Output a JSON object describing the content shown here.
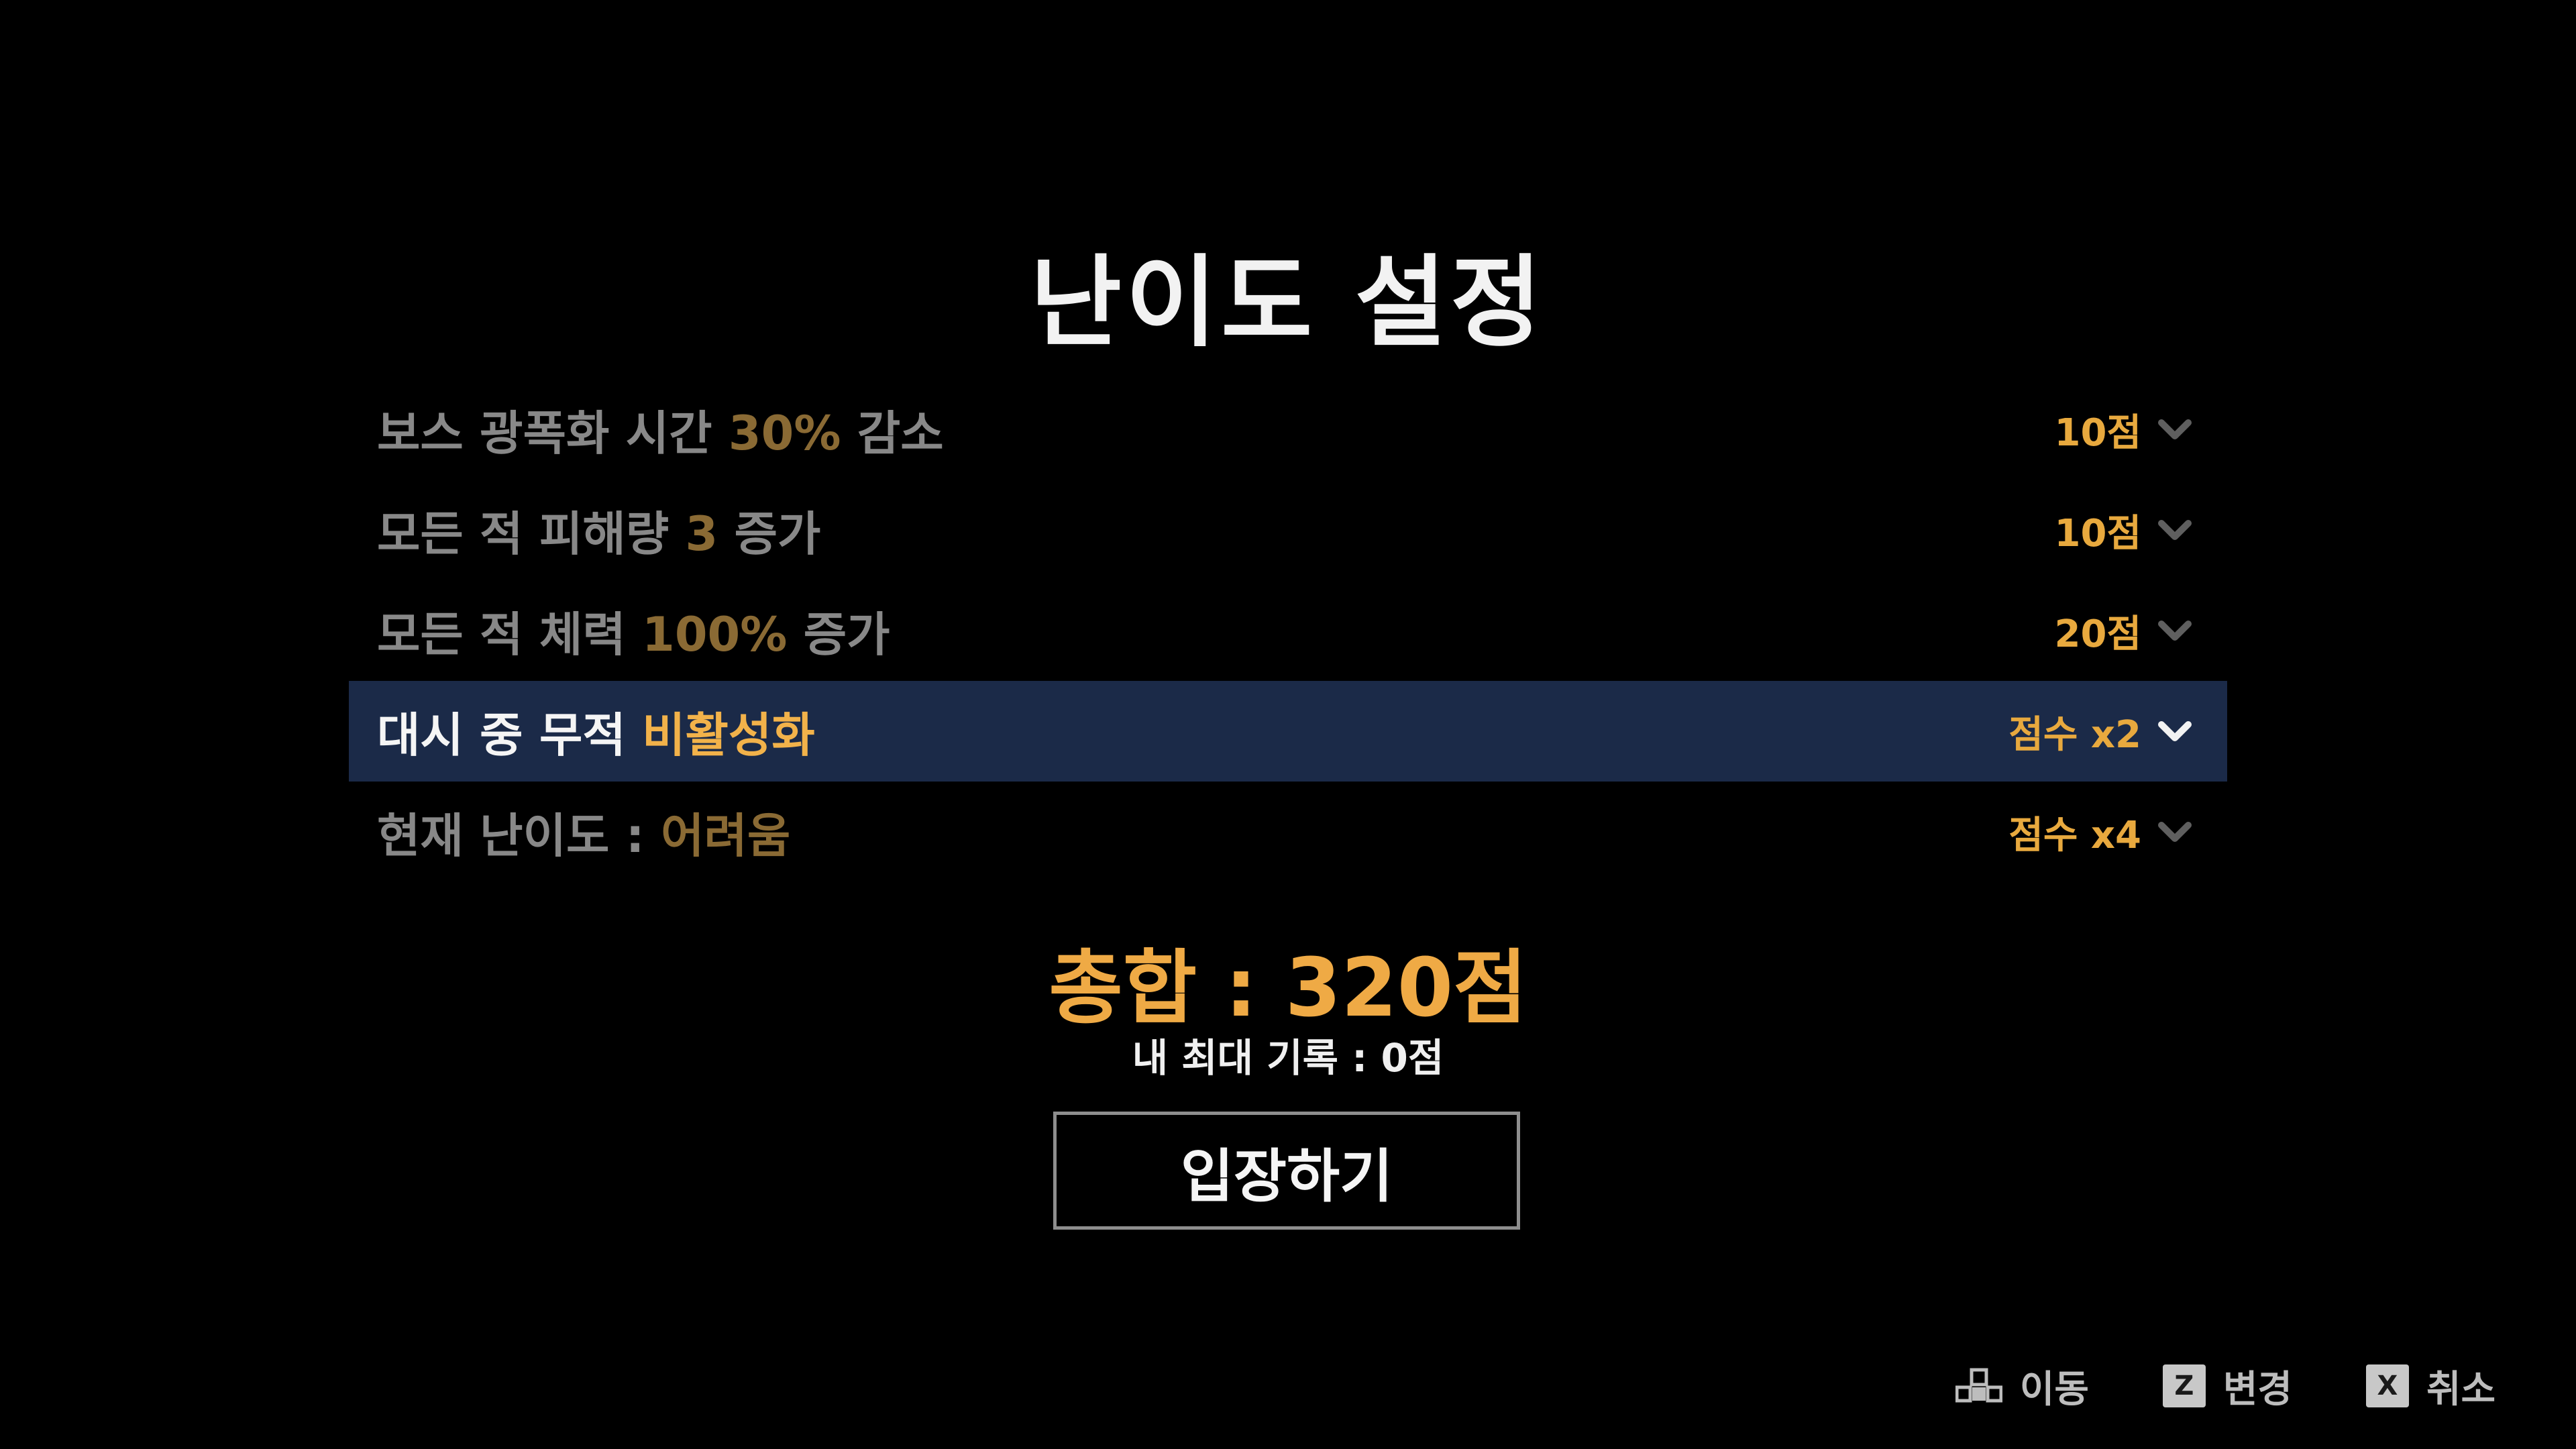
{
  "title": "난이도 설정",
  "options": [
    {
      "label_pre": "보스 광폭화 시간 ",
      "label_hl": "30%",
      "label_post": " 감소",
      "value": "10점",
      "icon": "chevron-down-icon",
      "selected": false
    },
    {
      "label_pre": "모든 적 피해량 ",
      "label_hl": "3",
      "label_post": " 증가",
      "value": "10점",
      "icon": "chevron-down-icon",
      "selected": false
    },
    {
      "label_pre": "모든 적 체력 ",
      "label_hl": "100%",
      "label_post": " 증가",
      "value": "20점",
      "icon": "chevron-down-icon",
      "selected": false
    },
    {
      "label_pre": "대시 중 무적 ",
      "label_hl": "비활성화",
      "label_post": "",
      "value": "점수 x2",
      "icon": "chevron-down-icon",
      "selected": true
    },
    {
      "label_pre": "현재 난이도 : ",
      "label_hl": "어려움",
      "label_post": "",
      "value": "점수 x4",
      "icon": "chevron-down-icon",
      "selected": false
    }
  ],
  "total": "총합 : 320점",
  "best_record": "내 최대 기록 : 0점",
  "enter_button": "입장하기",
  "hints": [
    {
      "key": "",
      "icon": "dpad-icon",
      "label": "이동"
    },
    {
      "key": "Z",
      "icon": "z-key-icon",
      "label": "변경"
    },
    {
      "key": "X",
      "icon": "x-key-icon",
      "label": "취소"
    }
  ],
  "colors": {
    "background": "#000000",
    "accent": "#efaa45",
    "dim_accent": "#8a6a34",
    "selected_row": "#1b2a48",
    "dim_text": "#888888"
  }
}
